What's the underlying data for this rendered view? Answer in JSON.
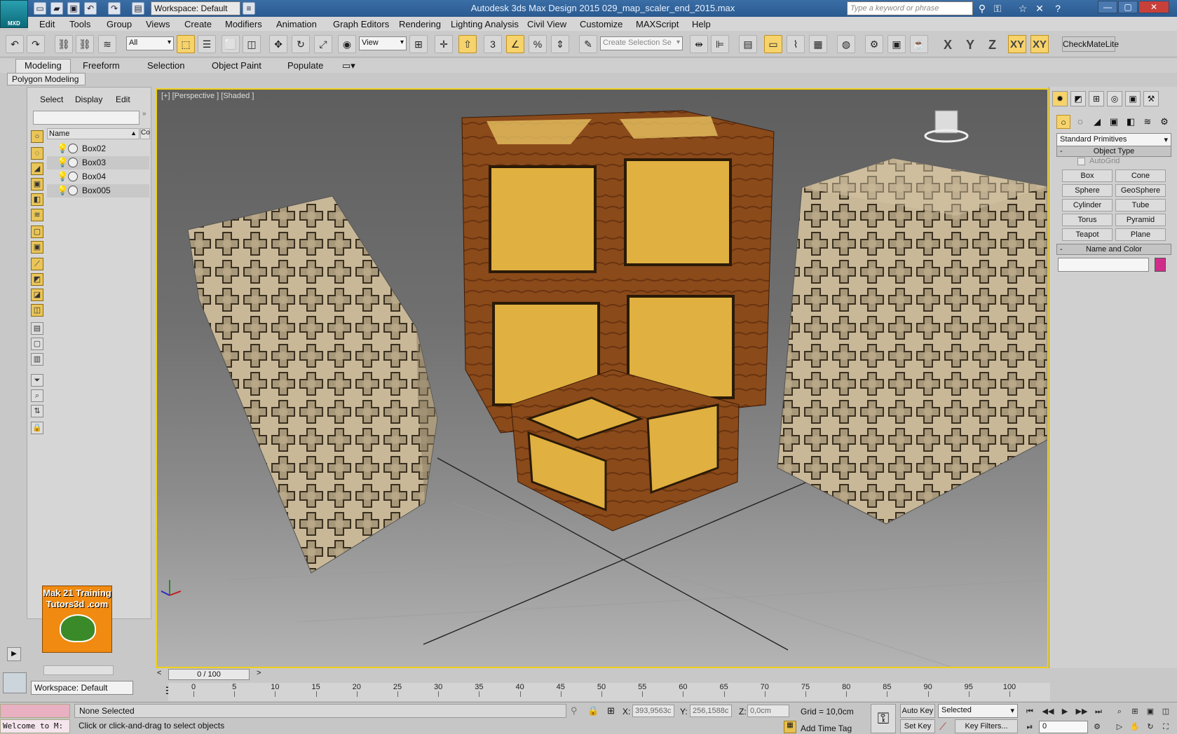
{
  "app": {
    "title": "Autodesk 3ds Max Design 2015     029_map_scaler_end_2015.max",
    "logo_label": "MXD",
    "workspace": "Workspace: Default",
    "search_placeholder": "Type a keyword or phrase"
  },
  "menu": [
    "Edit",
    "Tools",
    "Group",
    "Views",
    "Create",
    "Modifiers",
    "Animation",
    "Graph Editors",
    "Rendering",
    "Lighting Analysis",
    "Civil View",
    "Customize",
    "MAXScript",
    "Help"
  ],
  "toolbar": {
    "filter": "All",
    "ref_coord": "View",
    "selection_set_placeholder": "Create Selection Se",
    "snap_label": "3",
    "axes": [
      "X",
      "Y",
      "Z",
      "XY",
      "XY"
    ],
    "checkmate": "CheckMateLite"
  },
  "ribbon": {
    "tabs": [
      "Modeling",
      "Freeform",
      "Selection",
      "Object Paint",
      "Populate"
    ],
    "active_tab": "Modeling",
    "panel": "Polygon Modeling"
  },
  "explorer": {
    "menu": [
      "Select",
      "Display",
      "Edit"
    ],
    "column_name": "Name",
    "column_2": "Co",
    "objects": [
      "Box02",
      "Box03",
      "Box04",
      "Box005"
    ],
    "promo_line1": "Mak 21 Training",
    "promo_line2": "Tutors3d .com"
  },
  "viewport": {
    "label": "[+] [Perspective ] [Shaded ]"
  },
  "command_panel": {
    "category": "Standard Primitives",
    "object_type_title": "Object Type",
    "autogrid": "AutoGrid",
    "primitives": [
      "Box",
      "Cone",
      "Sphere",
      "GeoSphere",
      "Cylinder",
      "Tube",
      "Torus",
      "Pyramid",
      "Teapot",
      "Plane"
    ],
    "name_color_title": "Name and Color",
    "object_color": "#d02c8a"
  },
  "timeline": {
    "slider": "0 / 100",
    "ticks": [
      "0",
      "5",
      "10",
      "15",
      "20",
      "25",
      "30",
      "35",
      "40",
      "45",
      "50",
      "55",
      "60",
      "65",
      "70",
      "75",
      "80",
      "85",
      "90",
      "95",
      "100"
    ]
  },
  "status": {
    "welcome": "Welcome to M:",
    "selection": "None Selected",
    "prompt": "Click or click-and-drag to select objects",
    "x_label": "X:",
    "x": "393,9563c",
    "y_label": "Y:",
    "y": "256,1588c",
    "z_label": "Z:",
    "z": "0,0cm",
    "grid": "Grid = 10,0cm",
    "add_time_tag": "Add Time Tag",
    "auto_key": "Auto Key",
    "set_key": "Set Key",
    "key_mode": "Selected",
    "key_filters": "Key Filters...",
    "frame": "0"
  },
  "colors": {
    "accent": "#f6d36b",
    "viewport_border": "#f0d01c"
  }
}
